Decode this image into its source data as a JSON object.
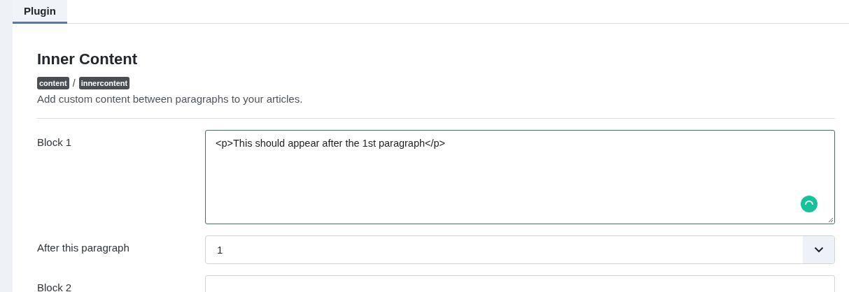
{
  "tabs": [
    {
      "label": "Plugin",
      "selected": true
    }
  ],
  "heading": "Inner Content",
  "tags": [
    "content",
    "innercontent"
  ],
  "tag_separator": "/",
  "description": "Add custom content between paragraphs to your articles.",
  "fields": [
    {
      "kind": "textarea",
      "label": "Block 1",
      "value": "<p>This should appear after the 1st paragraph</p>"
    },
    {
      "kind": "select",
      "label": "After this paragraph",
      "value": "1"
    },
    {
      "kind": "textarea",
      "label": "Block 2"
    }
  ]
}
